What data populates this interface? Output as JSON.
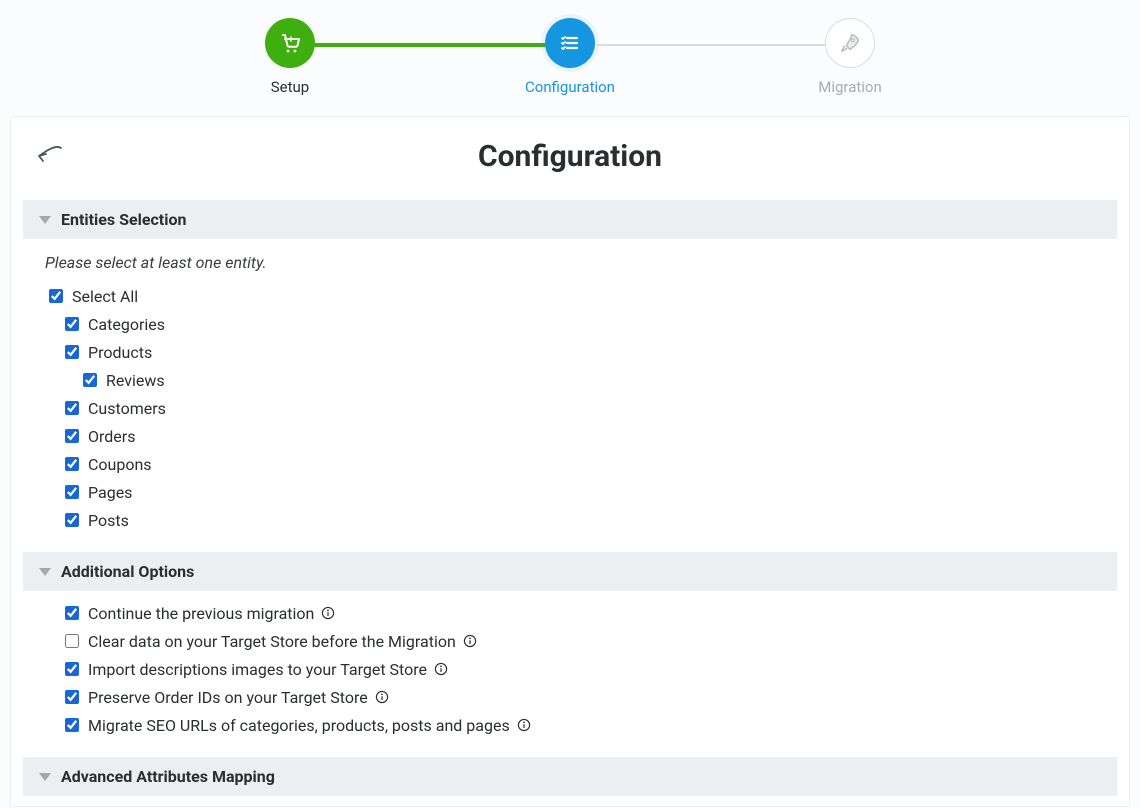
{
  "stepper": {
    "steps": [
      {
        "label": "Setup",
        "state": "done"
      },
      {
        "label": "Configuration",
        "state": "active"
      },
      {
        "label": "Migration",
        "state": "pending"
      }
    ]
  },
  "page": {
    "title": "Configuration"
  },
  "entities_section": {
    "title": "Entities Selection",
    "hint": "Please select at least one entity.",
    "select_all_label": "Select All",
    "select_all_checked": true,
    "items": [
      {
        "label": "Categories",
        "checked": true
      },
      {
        "label": "Products",
        "checked": true,
        "children": [
          {
            "label": "Reviews",
            "checked": true
          }
        ]
      },
      {
        "label": "Customers",
        "checked": true
      },
      {
        "label": "Orders",
        "checked": true
      },
      {
        "label": "Coupons",
        "checked": true
      },
      {
        "label": "Pages",
        "checked": true
      },
      {
        "label": "Posts",
        "checked": true
      }
    ]
  },
  "options_section": {
    "title": "Additional Options",
    "items": [
      {
        "label": "Continue the previous migration",
        "checked": true,
        "has_info": true
      },
      {
        "label": "Clear data on your Target Store before the Migration",
        "checked": false,
        "has_info": true
      },
      {
        "label": "Import descriptions images to your Target Store",
        "checked": true,
        "has_info": true
      },
      {
        "label": "Preserve Order IDs on your Target Store",
        "checked": true,
        "has_info": true
      },
      {
        "label": "Migrate SEO URLs of categories, products, posts and pages",
        "checked": true,
        "has_info": true
      }
    ]
  },
  "advanced_section": {
    "title": "Advanced Attributes Mapping"
  }
}
